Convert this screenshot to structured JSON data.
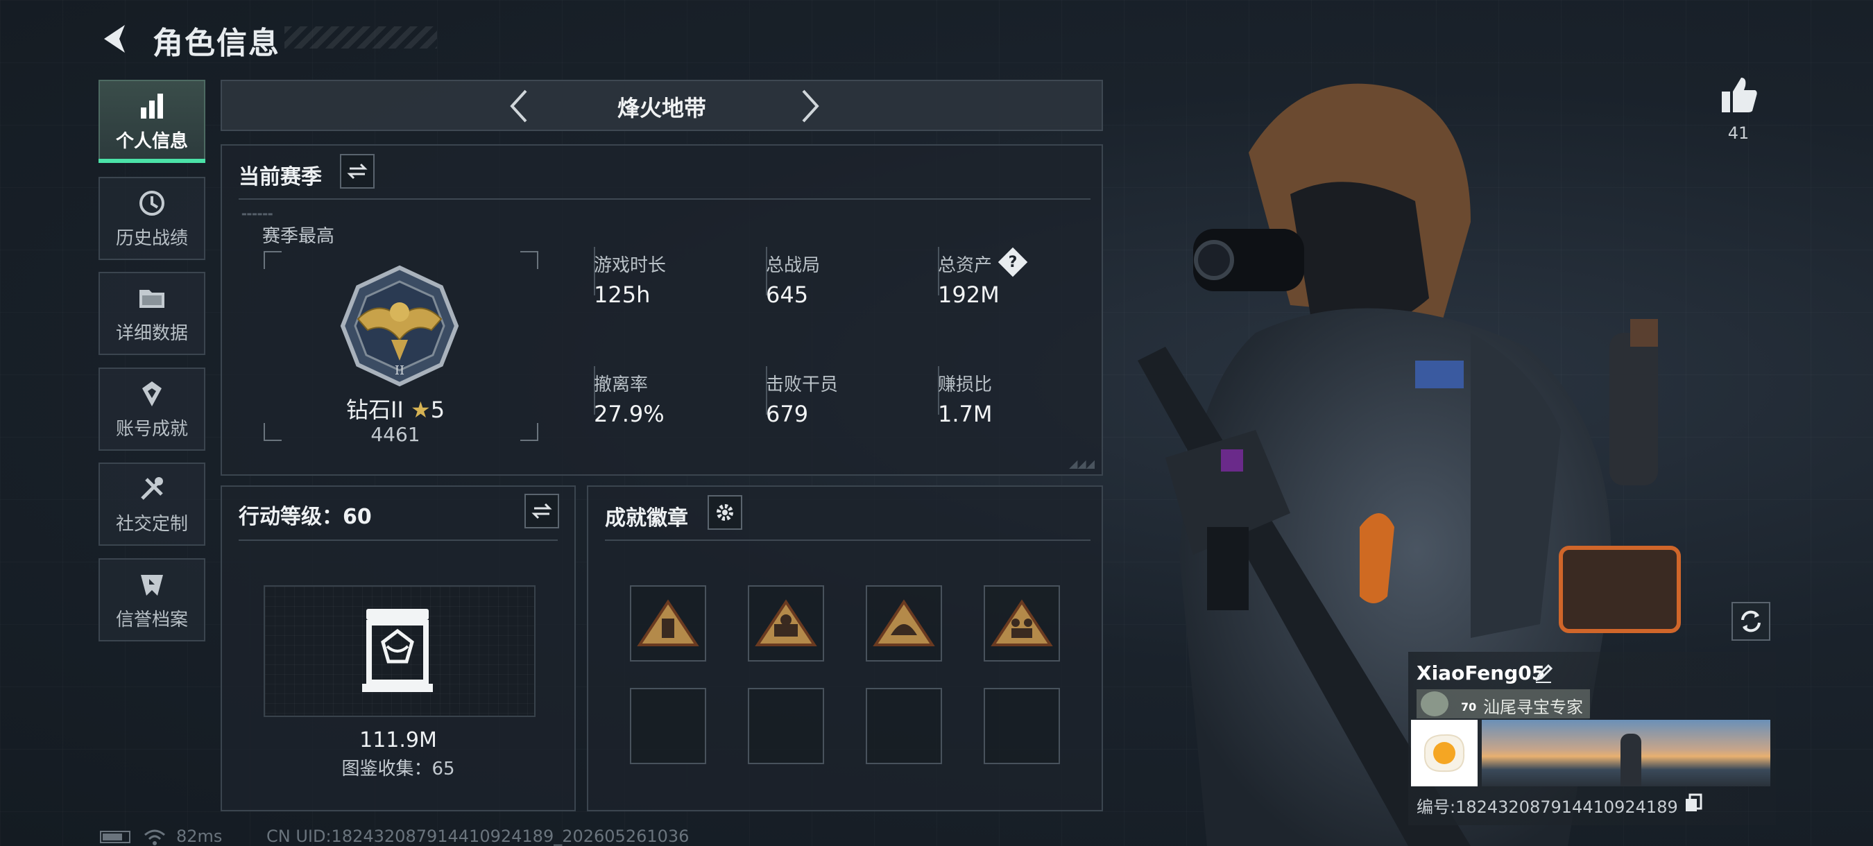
{
  "header": {
    "title": "角色信息"
  },
  "sidebar": {
    "items": [
      {
        "label": "个人信息",
        "icon": "bar-chart-icon",
        "active": true
      },
      {
        "label": "历史战绩",
        "icon": "history-icon"
      },
      {
        "label": "详细数据",
        "icon": "folder-icon"
      },
      {
        "label": "账号成就",
        "icon": "achievement-icon"
      },
      {
        "label": "社交定制",
        "icon": "tools-icon"
      },
      {
        "label": "信誉档案",
        "icon": "credit-shield-icon"
      }
    ]
  },
  "mode_tabs": {
    "current": "烽火地带"
  },
  "season": {
    "title": "当前赛季",
    "best_label": "赛季最高",
    "rank_name": "钻石II",
    "rank_stars": "5",
    "rank_score": "4461",
    "stats": [
      {
        "label": "游戏时长",
        "value": "125h"
      },
      {
        "label": "总战局",
        "value": "645"
      },
      {
        "label": "总资产",
        "value": "192M",
        "help": "?"
      },
      {
        "label": "撤离率",
        "value": "27.9%"
      },
      {
        "label": "击败干员",
        "value": "679"
      },
      {
        "label": "赚损比",
        "value": "1.7M"
      }
    ]
  },
  "action_level": {
    "title": "行动等级：60",
    "value": "111.9M",
    "collection": "图鉴收集：65"
  },
  "achievements": {
    "title": "成就徽章",
    "badges": [
      "badge-dogtag-icon",
      "badge-vehicle-icon",
      "badge-helmet-icon",
      "badge-squad-icon"
    ],
    "empty_slots": 4
  },
  "profile": {
    "likes": "41",
    "name": "XiaoFeng05",
    "avatar_level": "70",
    "title_text": "汕尾寻宝专家",
    "uid_line": "编号:18243208791441092418​9"
  },
  "footer": {
    "ping": "82ms",
    "uid": "CN UID:18243208791441092418​9_202605261036"
  },
  "colors": {
    "accent": "#4be2a8",
    "gold": "#c8a24a",
    "panel_border": "#3b454f"
  }
}
